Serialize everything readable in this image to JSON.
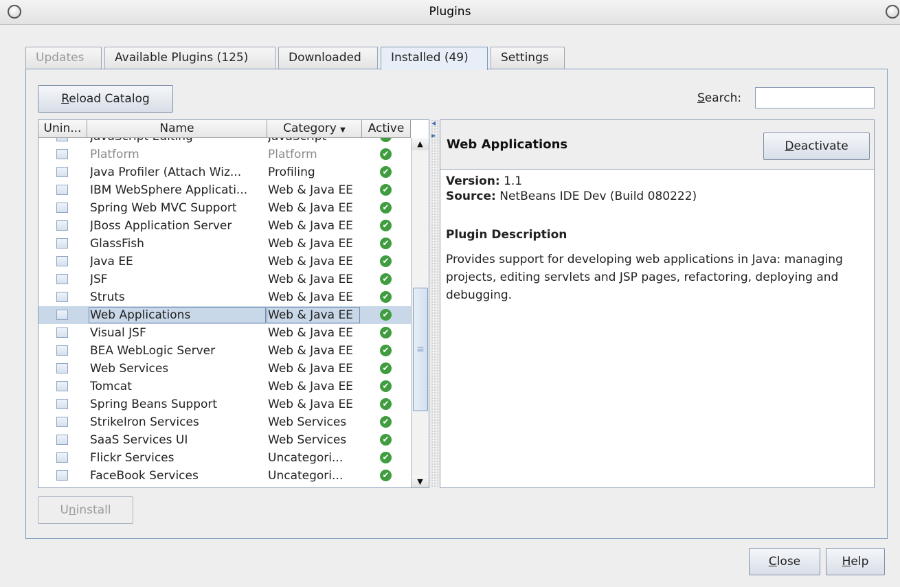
{
  "window": {
    "title": "Plugins"
  },
  "tabs": [
    {
      "label": "Updates",
      "state": "disabled"
    },
    {
      "label": "Available Plugins (125)",
      "state": "normal"
    },
    {
      "label": "Downloaded",
      "state": "normal"
    },
    {
      "label": "Installed (49)",
      "state": "active"
    },
    {
      "label": "Settings",
      "state": "normal"
    }
  ],
  "toolbar": {
    "reload_mnemonic": "R",
    "reload_rest": "eload Catalog",
    "search_mnemonic": "S",
    "search_rest": "earch:",
    "search_value": ""
  },
  "table": {
    "columns": [
      "Unin...",
      "Name",
      "Category",
      "Active"
    ],
    "sort_icon": "sort-descending-icon",
    "rows": [
      {
        "name": "JavaScript Editing",
        "category": "JavaScript",
        "dim": false,
        "selected": false
      },
      {
        "name": "Platform",
        "category": "Platform",
        "dim": true,
        "selected": false
      },
      {
        "name": "Java Profiler (Attach Wiz...",
        "category": "Profiling",
        "dim": false,
        "selected": false
      },
      {
        "name": "IBM WebSphere Applicati...",
        "category": "Web & Java EE",
        "dim": false,
        "selected": false
      },
      {
        "name": "Spring Web MVC Support",
        "category": "Web & Java EE",
        "dim": false,
        "selected": false
      },
      {
        "name": "JBoss Application Server",
        "category": "Web & Java EE",
        "dim": false,
        "selected": false
      },
      {
        "name": "GlassFish",
        "category": "Web & Java EE",
        "dim": false,
        "selected": false
      },
      {
        "name": "Java EE",
        "category": "Web & Java EE",
        "dim": false,
        "selected": false
      },
      {
        "name": "JSF",
        "category": "Web & Java EE",
        "dim": false,
        "selected": false
      },
      {
        "name": "Struts",
        "category": "Web & Java EE",
        "dim": false,
        "selected": false
      },
      {
        "name": "Web Applications",
        "category": "Web & Java EE",
        "dim": false,
        "selected": true
      },
      {
        "name": "Visual JSF",
        "category": "Web & Java EE",
        "dim": false,
        "selected": false
      },
      {
        "name": "BEA WebLogic Server",
        "category": "Web & Java EE",
        "dim": false,
        "selected": false
      },
      {
        "name": "Web Services",
        "category": "Web & Java EE",
        "dim": false,
        "selected": false
      },
      {
        "name": "Tomcat",
        "category": "Web & Java EE",
        "dim": false,
        "selected": false
      },
      {
        "name": "Spring Beans Support",
        "category": "Web & Java EE",
        "dim": false,
        "selected": false
      },
      {
        "name": "StrikeIron Services",
        "category": "Web Services",
        "dim": false,
        "selected": false
      },
      {
        "name": "SaaS Services UI",
        "category": "Web Services",
        "dim": false,
        "selected": false
      },
      {
        "name": "Flickr Services",
        "category": "Uncategori...",
        "dim": false,
        "selected": false
      },
      {
        "name": "FaceBook Services",
        "category": "Uncategori...",
        "dim": false,
        "selected": false
      }
    ]
  },
  "details": {
    "title": "Web Applications",
    "deactivate_mnemonic": "D",
    "deactivate_rest": "eactivate",
    "version_label": "Version:",
    "version_value": "1.1",
    "source_label": "Source:",
    "source_value": "NetBeans IDE Dev (Build 080222)",
    "description_title": "Plugin Description",
    "description": "Provides support for developing web applications in Java: managing projects, editing servlets and JSP pages, refactoring, deploying and debugging."
  },
  "footer": {
    "uninstall_pre": "U",
    "uninstall_mnemonic": "n",
    "uninstall_rest": "install",
    "close_mnemonic": "C",
    "close_rest": "lose",
    "help_mnemonic": "H",
    "help_rest": "elp"
  },
  "colors": {
    "active_check": "#3f9d3f",
    "tab_border": "#7d99bd",
    "selection": "#c9d8e8"
  }
}
